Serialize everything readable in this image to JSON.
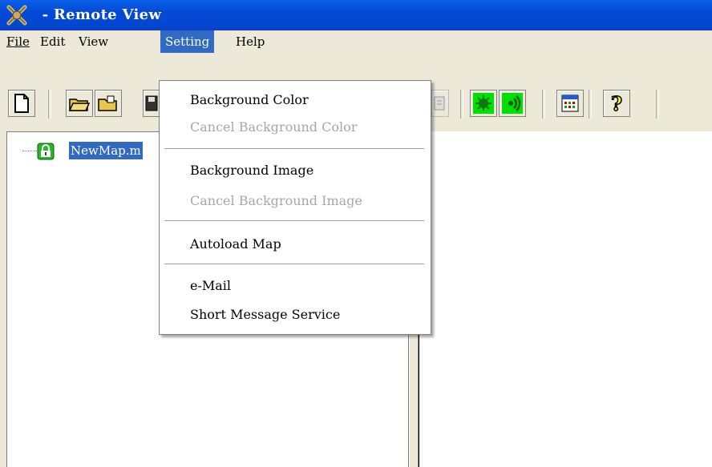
{
  "window": {
    "title": " - Remote View",
    "app_icon": "remote-view-app-icon"
  },
  "menubar": {
    "items": [
      {
        "label": "File",
        "mnemonic": "F"
      },
      {
        "label": "Edit",
        "mnemonic": "E"
      },
      {
        "label": "View",
        "mnemonic": "V"
      },
      {
        "label": "Setting",
        "mnemonic": "S",
        "active": true
      },
      {
        "label": "Help",
        "mnemonic": "H"
      }
    ]
  },
  "setting_menu": {
    "items": [
      {
        "label": "Background Color",
        "enabled": true
      },
      {
        "label": "Cancel Background Color",
        "enabled": false
      },
      {
        "label": "Background Image",
        "enabled": true
      },
      {
        "label": "Cancel Background Image",
        "enabled": false
      },
      {
        "label": "Autoload Map",
        "enabled": true
      },
      {
        "label": "e-Mail",
        "enabled": true
      },
      {
        "label": "Short Message Service",
        "enabled": true
      }
    ]
  },
  "toolbar": {
    "buttons": [
      "new-file-icon",
      "open-folder-icon",
      "open-icon",
      "save-icon",
      "print-icon",
      "green-bug-icon",
      "green-signal-icon",
      "calendar-grid-icon",
      "help-question-icon"
    ]
  },
  "tree": {
    "root_label": "NewMap.m"
  },
  "colors": {
    "titlebar": "#0449d6",
    "selection": "#316ac5",
    "face": "#ece9d8"
  }
}
